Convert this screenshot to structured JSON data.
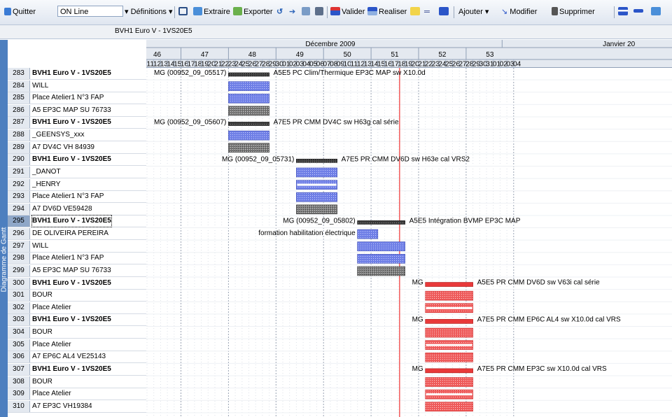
{
  "toolbar": {
    "quit_label": "Quitter",
    "status_value": "ON Line",
    "definitions_label": "Définitions",
    "extract_label": "Extraire",
    "export_label": "Exporter",
    "validate_label": "Valider",
    "realize_label": "Realiser",
    "add_label": "Ajouter",
    "modify_label": "Modifier",
    "delete_label": "Supprimer"
  },
  "project": {
    "label": "BVH1 Euro V - 1VS20E5"
  },
  "side_tab": {
    "label": "Diagramme de Gantt"
  },
  "timeline": {
    "months": [
      "Décembre 2009",
      "Janvier 20"
    ],
    "weeks": [
      "46",
      "47",
      "48",
      "49",
      "50",
      "51",
      "52",
      "53"
    ],
    "days": [
      "11",
      "12",
      "13",
      "14",
      "15",
      "16",
      "17",
      "18",
      "19",
      "20",
      "21",
      "22",
      "23",
      "24",
      "25",
      "26",
      "27",
      "28",
      "29",
      "30",
      "01",
      "02",
      "03",
      "04",
      "05",
      "06",
      "07",
      "08",
      "09",
      "10",
      "11",
      "12",
      "13",
      "14",
      "15",
      "16",
      "17",
      "18",
      "19",
      "20",
      "21",
      "22",
      "23",
      "24",
      "25",
      "26",
      "27",
      "28",
      "29",
      "30",
      "31",
      "01",
      "02",
      "03",
      "04"
    ]
  },
  "rows": [
    {
      "num": "283",
      "label": "BVH1 Euro V - 1VS20E5",
      "bold": true
    },
    {
      "num": "284",
      "label": "WILL",
      "bold": false
    },
    {
      "num": "285",
      "label": "Place Atelier1 N°3 FAP",
      "bold": false
    },
    {
      "num": "286",
      "label": "A5 EP3C MAP SU 76733",
      "bold": false
    },
    {
      "num": "287",
      "label": "BVH1 Euro V - 1VS20E5",
      "bold": true
    },
    {
      "num": "288",
      "label": "_GEENSYS_xxx",
      "bold": false
    },
    {
      "num": "289",
      "label": "A7 DV4C VH 84939",
      "bold": false
    },
    {
      "num": "290",
      "label": "BVH1 Euro V - 1VS20E5",
      "bold": true
    },
    {
      "num": "291",
      "label": "_DANOT",
      "bold": false
    },
    {
      "num": "292",
      "label": "_HENRY",
      "bold": false
    },
    {
      "num": "293",
      "label": "Place Atelier1 N°3 FAP",
      "bold": false
    },
    {
      "num": "294",
      "label": "A7 DV6D VE59428",
      "bold": false
    },
    {
      "num": "295",
      "label": "BVH1 Euro V - 1VS20E5",
      "bold": true,
      "selected": true
    },
    {
      "num": "296",
      "label": "DE OLIVEIRA PEREIRA",
      "bold": false
    },
    {
      "num": "297",
      "label": "WILL",
      "bold": false
    },
    {
      "num": "298",
      "label": "Place Atelier1 N°3 FAP",
      "bold": false
    },
    {
      "num": "299",
      "label": "A5 EP3C MAP SU 76733",
      "bold": false
    },
    {
      "num": "300",
      "label": "BVH1 Euro V - 1VS20E5",
      "bold": true
    },
    {
      "num": "301",
      "label": "BOUR",
      "bold": false
    },
    {
      "num": "302",
      "label": "Place Atelier",
      "bold": false
    },
    {
      "num": "303",
      "label": "BVH1 Euro V - 1VS20E5",
      "bold": true
    },
    {
      "num": "304",
      "label": "BOUR",
      "bold": false
    },
    {
      "num": "305",
      "label": "Place Atelier",
      "bold": false
    },
    {
      "num": "306",
      "label": "A7 EP6C AL4 VE25143",
      "bold": false
    },
    {
      "num": "307",
      "label": "BVH1 Euro V - 1VS20E5",
      "bold": true
    },
    {
      "num": "308",
      "label": "BOUR",
      "bold": false
    },
    {
      "num": "309",
      "label": "Place Atelier",
      "bold": false
    },
    {
      "num": "310",
      "label": "A7 EP3C VH19384",
      "bold": false
    }
  ],
  "tasks": [
    {
      "row": 0,
      "start": 12,
      "end": 18,
      "style": "dark",
      "pre": "MG (00952_09_05517)",
      "post": "A5E5 PC Clim/Thermique EP3C MAP sw X10.0d"
    },
    {
      "row": 1,
      "start": 12,
      "end": 18,
      "style": "blue"
    },
    {
      "row": 2,
      "start": 12,
      "end": 18,
      "style": "blue"
    },
    {
      "row": 3,
      "start": 12,
      "end": 18,
      "style": "grey"
    },
    {
      "row": 4,
      "start": 12,
      "end": 18,
      "style": "dark",
      "pre": "MG (00952_09_05607)",
      "post": "A7E5 PR CMM DV4C sw H63g cal série"
    },
    {
      "row": 5,
      "start": 12,
      "end": 18,
      "style": "blue"
    },
    {
      "row": 6,
      "start": 12,
      "end": 18,
      "style": "grey"
    },
    {
      "row": 7,
      "start": 22,
      "end": 28,
      "style": "dark",
      "pre": "MG (00952_09_05731)",
      "post": "A7E5 PR CMM DV6D sw H63e cal VRS2"
    },
    {
      "row": 8,
      "start": 22,
      "end": 28,
      "style": "blue"
    },
    {
      "row": 9,
      "start": 22,
      "end": 28,
      "style": "bluew"
    },
    {
      "row": 10,
      "start": 22,
      "end": 28,
      "style": "blue"
    },
    {
      "row": 11,
      "start": 22,
      "end": 28,
      "style": "grey"
    },
    {
      "row": 12,
      "start": 31,
      "end": 38,
      "style": "dark",
      "pre": "MG (00952_09_05802)",
      "post": "A5E5 Intégration BVMP EP3C MAP"
    },
    {
      "row": 13,
      "start": 31,
      "end": 34,
      "style": "blue",
      "pre": "formation habilitation électrique"
    },
    {
      "row": 14,
      "start": 31,
      "end": 38,
      "style": "blue"
    },
    {
      "row": 15,
      "start": 31,
      "end": 38,
      "style": "blue"
    },
    {
      "row": 16,
      "start": 31,
      "end": 38,
      "style": "grey"
    },
    {
      "row": 17,
      "start": 41,
      "end": 48,
      "style": "red",
      "pre": "MG",
      "post": "A5E5 PR CMM DV6D sw V63i cal série"
    },
    {
      "row": 18,
      "start": 41,
      "end": 48,
      "style": "redh"
    },
    {
      "row": 19,
      "start": 41,
      "end": 48,
      "style": "redw"
    },
    {
      "row": 20,
      "start": 41,
      "end": 48,
      "style": "red",
      "pre": "MG",
      "post": "A7E5 PR CMM EP6C AL4 sw X10.0d cal VRS"
    },
    {
      "row": 21,
      "start": 41,
      "end": 48,
      "style": "redh"
    },
    {
      "row": 22,
      "start": 41,
      "end": 48,
      "style": "redw"
    },
    {
      "row": 23,
      "start": 41,
      "end": 48,
      "style": "redh"
    },
    {
      "row": 24,
      "start": 41,
      "end": 48,
      "style": "red",
      "pre": "MG",
      "post": "A7E5 PR CMM EP3C sw X10.0d cal VRS"
    },
    {
      "row": 25,
      "start": 41,
      "end": 48,
      "style": "redh"
    },
    {
      "row": 26,
      "start": 41,
      "end": 48,
      "style": "redw"
    },
    {
      "row": 27,
      "start": 41,
      "end": 48,
      "style": "redh"
    }
  ],
  "today_day_index": 37.2,
  "colors": {
    "accent": "#4d7fbf",
    "today_line": "#e33",
    "task_blue": "#5a6bd8",
    "task_red": "#e8393a",
    "task_dark": "#3a3a3a"
  }
}
